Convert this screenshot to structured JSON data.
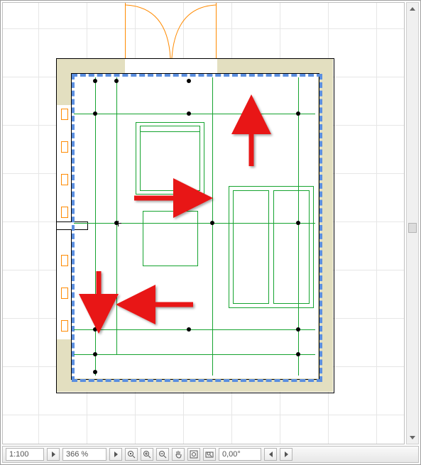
{
  "status": {
    "scale": "1:100",
    "zoom": "366 %",
    "angle": "0,00°"
  },
  "icons": {
    "step_next": "step-next-icon",
    "zoom_sel": "zoom-selection-icon",
    "zoom_in": "zoom-in-icon",
    "zoom_out": "zoom-out-icon",
    "pan": "pan-hand-icon",
    "fit": "zoom-fit-icon",
    "zoom_window": "zoom-window-icon",
    "angle_prev": "angle-step-prev-icon",
    "angle_next": "angle-step-next-icon",
    "scroll_up": "scroll-up-icon",
    "scroll_down": "scroll-down-icon",
    "vscroll_thumb": "vscroll-thumb"
  }
}
